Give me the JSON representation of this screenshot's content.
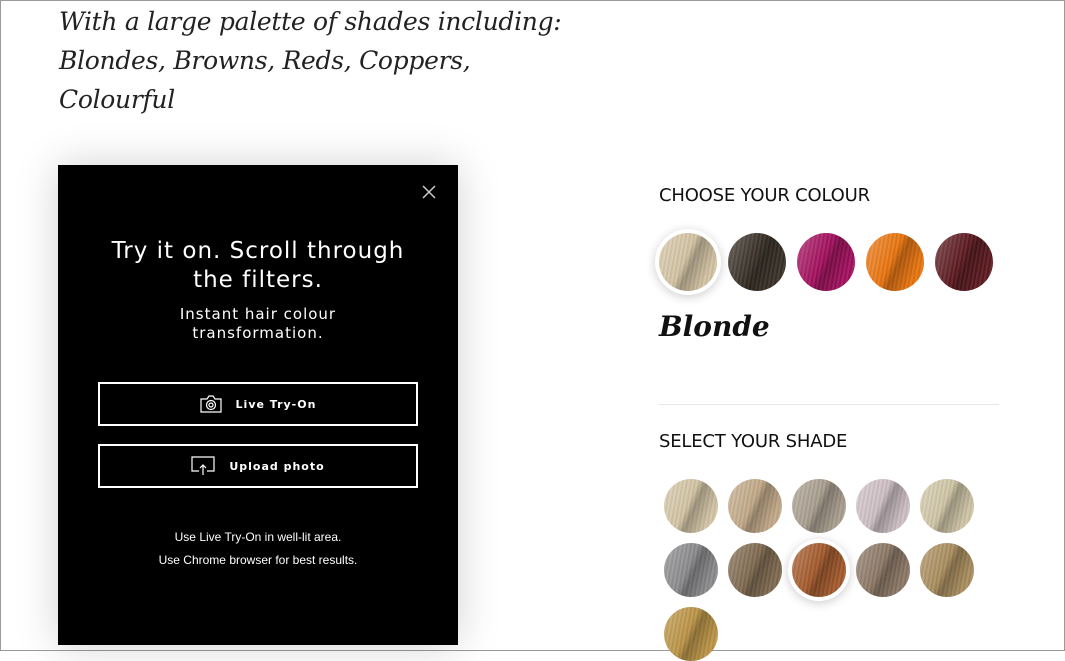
{
  "intro": {
    "lines": [
      "With a large palette of shades including:",
      "Blondes, Browns, Reds, Coppers,",
      "Colourful"
    ]
  },
  "tryon": {
    "title_line1": "Try it on. Scroll through",
    "title_line2": "the filters.",
    "subtitle_line1": "Instant hair colour",
    "subtitle_line2": "transformation.",
    "live_label": "Live Try-On",
    "upload_label": "Upload photo",
    "note1": "Use Live Try-On in well-lit area.",
    "note2": "Use Chrome browser for best results.",
    "close_icon": "close-icon"
  },
  "colour": {
    "heading": "CHOOSE YOUR COLOUR",
    "selected_name": "Blonde",
    "selected_index": 0,
    "swatches": [
      "#d3c3a3",
      "#3a3128",
      "#a3105e",
      "#e8740f",
      "#5c1a20"
    ]
  },
  "shade": {
    "heading": "SELECT YOUR SHADE",
    "selected_index": 7,
    "swatches": [
      "#d2c4a4",
      "#c2a988",
      "#a99e8f",
      "#cdbfc4",
      "#cfc5a6",
      "#8b8b8d",
      "#7f6a50",
      "#a45a2c",
      "#8c7866",
      "#a98d5e",
      "#bb9446"
    ]
  }
}
